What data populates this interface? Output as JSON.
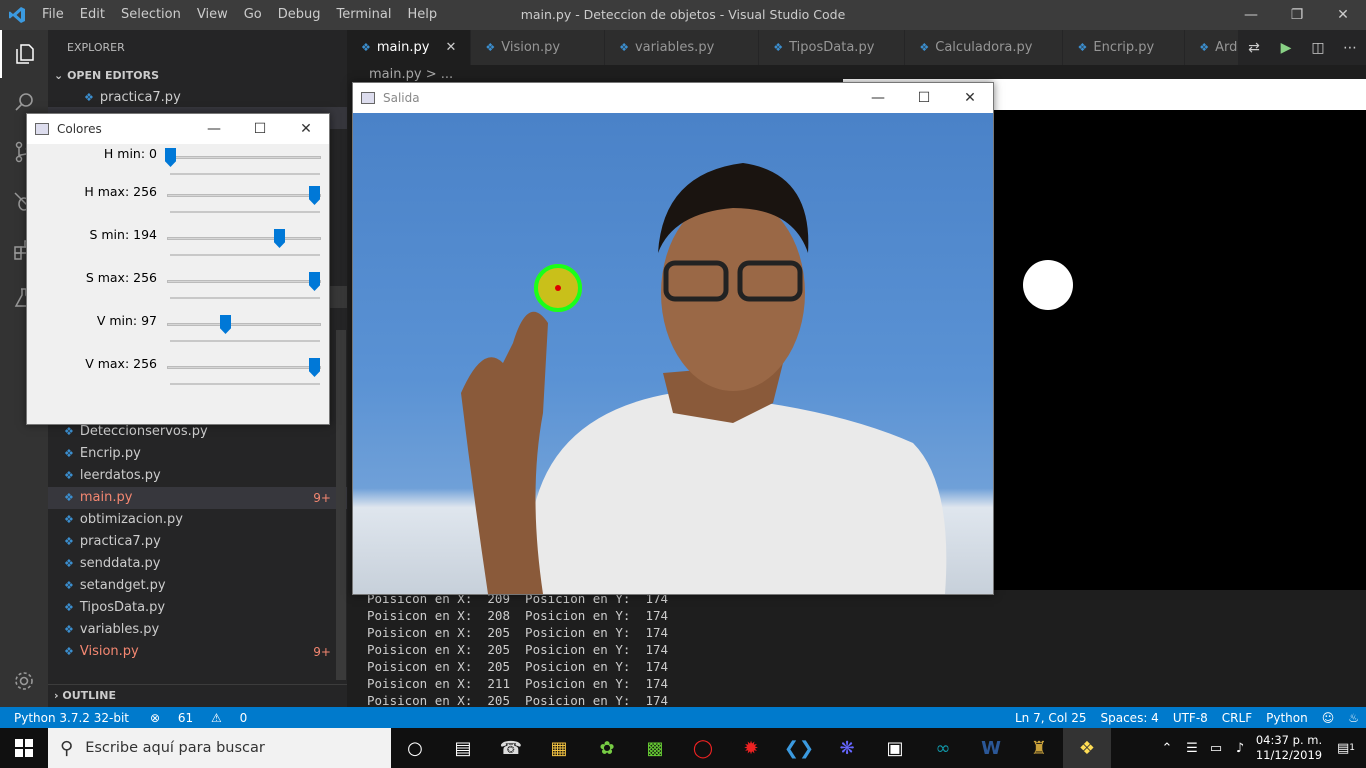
{
  "titlebar": {
    "title": "main.py - Deteccion de objetos - Visual Studio Code",
    "menu": [
      "File",
      "Edit",
      "Selection",
      "View",
      "Go",
      "Debug",
      "Terminal",
      "Help"
    ]
  },
  "sidebar": {
    "header": "EXPLORER",
    "open_editors": "OPEN EDITORS",
    "open_file": "practica7.py",
    "outline": "OUTLINE",
    "files": [
      {
        "name": "Deteccionservos.py",
        "badge": ""
      },
      {
        "name": "Encrip.py",
        "badge": ""
      },
      {
        "name": "leerdatos.py",
        "badge": ""
      },
      {
        "name": "main.py",
        "badge": "9+"
      },
      {
        "name": "obtimizacion.py",
        "badge": ""
      },
      {
        "name": "practica7.py",
        "badge": ""
      },
      {
        "name": "senddata.py",
        "badge": ""
      },
      {
        "name": "setandget.py",
        "badge": ""
      },
      {
        "name": "TiposData.py",
        "badge": ""
      },
      {
        "name": "variables.py",
        "badge": ""
      },
      {
        "name": "Vision.py",
        "badge": "9+"
      }
    ]
  },
  "tabs": [
    "main.py",
    "Vision.py",
    "variables.py",
    "TiposData.py",
    "Calculadora.py",
    "Encrip.py",
    "Arduino.py"
  ],
  "breadcrumb": "main.py > ...",
  "colores": {
    "title": "Colores",
    "sliders": [
      {
        "label": "H min: 0",
        "level": 0.0
      },
      {
        "label": "H max: 256",
        "level": 1.0
      },
      {
        "label": "S min: 194",
        "level": 0.758
      },
      {
        "label": "S max: 256",
        "level": 1.0
      },
      {
        "label": "V min: 97",
        "level": 0.379
      },
      {
        "label": "V max: 256",
        "level": 1.0
      }
    ]
  },
  "salida": {
    "title": "Salida"
  },
  "terminal": {
    "lines": [
      "Poisicon en X:  209  Posicion en Y:  174",
      "Poisicon en X:  208  Posicion en Y:  174",
      "Poisicon en X:  205  Posicion en Y:  174",
      "Poisicon en X:  205  Posicion en Y:  174",
      "Poisicon en X:  205  Posicion en Y:  174",
      "Poisicon en X:  211  Posicion en Y:  174",
      "Poisicon en X:  205  Posicion en Y:  174"
    ]
  },
  "status": {
    "python": "Python 3.7.2 32-bit",
    "errors": "61",
    "warnings": "0",
    "position": "Ln 7, Col 25",
    "spaces": "Spaces: 4",
    "encoding": "UTF-8",
    "eol": "CRLF",
    "lang": "Python"
  },
  "taskbar": {
    "search_placeholder": "Escribe aquí para buscar",
    "time": "04:37 p. m.",
    "date": "11/12/2019",
    "notif_count": "1"
  },
  "colors": {
    "accent": "#007acc",
    "activity": "#333333",
    "sidebar": "#252526"
  }
}
